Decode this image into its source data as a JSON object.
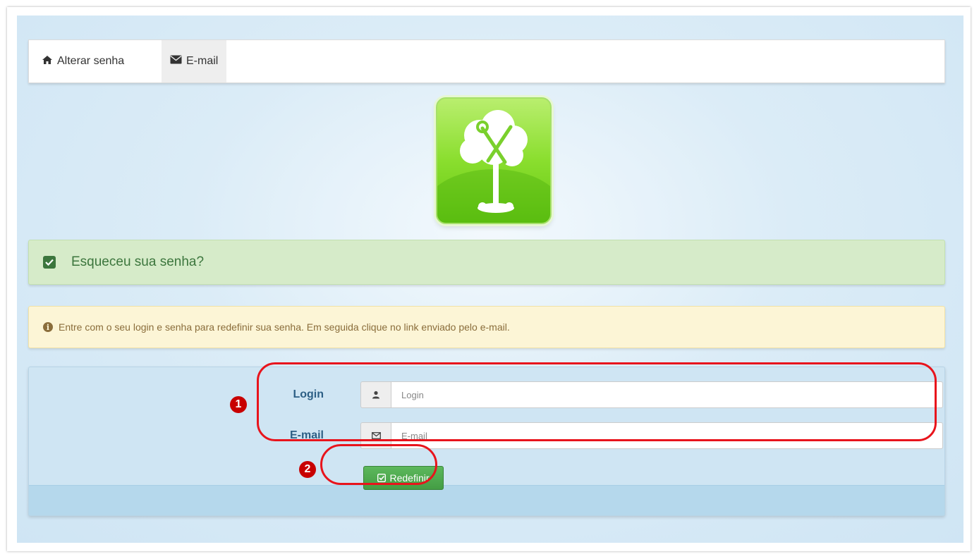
{
  "nav": {
    "tabs": [
      {
        "label": "Alterar senha",
        "icon": "home-icon"
      },
      {
        "label": "E-mail",
        "icon": "envelope-icon",
        "active": true
      }
    ]
  },
  "logo": {
    "icon": "tree-tools-logo"
  },
  "success_alert": {
    "text": "Esqueceu sua senha?",
    "icon": "check-square-icon",
    "color": "#3c763d"
  },
  "info_alert": {
    "text": "Entre com o seu login e senha para redefinir sua senha. Em seguida clique no link enviado pelo e-mail.",
    "icon": "info-circle-icon"
  },
  "form": {
    "login": {
      "label": "Login",
      "placeholder": "Login",
      "value": "",
      "icon": "user-icon"
    },
    "email": {
      "label": "E-mail",
      "placeholder": "E-mail",
      "value": "",
      "icon": "envelope-outline-icon"
    },
    "submit_label": "Redefinir"
  },
  "annotations": {
    "step1": "1",
    "step2": "2",
    "color": "#e8141c"
  }
}
